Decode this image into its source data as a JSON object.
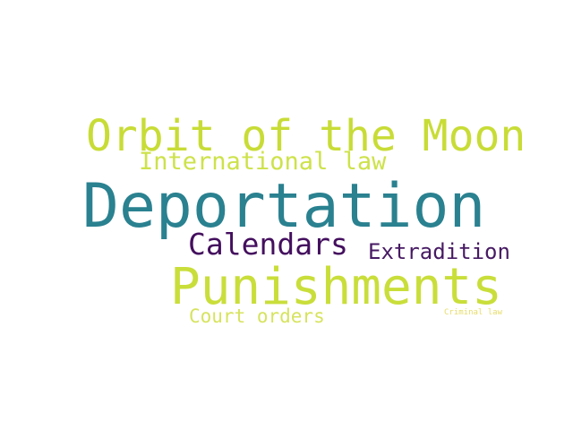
{
  "words": [
    {
      "text": "Orbit of the Moon",
      "color": "#c8dc36"
    },
    {
      "text": "International law",
      "color": "#cde24a"
    },
    {
      "text": "Deportation",
      "color": "#2a8190"
    },
    {
      "text": "Calendars",
      "color": "#440f5e"
    },
    {
      "text": "Extradition",
      "color": "#471a63"
    },
    {
      "text": "Punishments",
      "color": "#c9de3a"
    },
    {
      "text": "Court orders",
      "color": "#d6e35e"
    },
    {
      "text": "Criminal law",
      "color": "#e6dd6a"
    }
  ]
}
